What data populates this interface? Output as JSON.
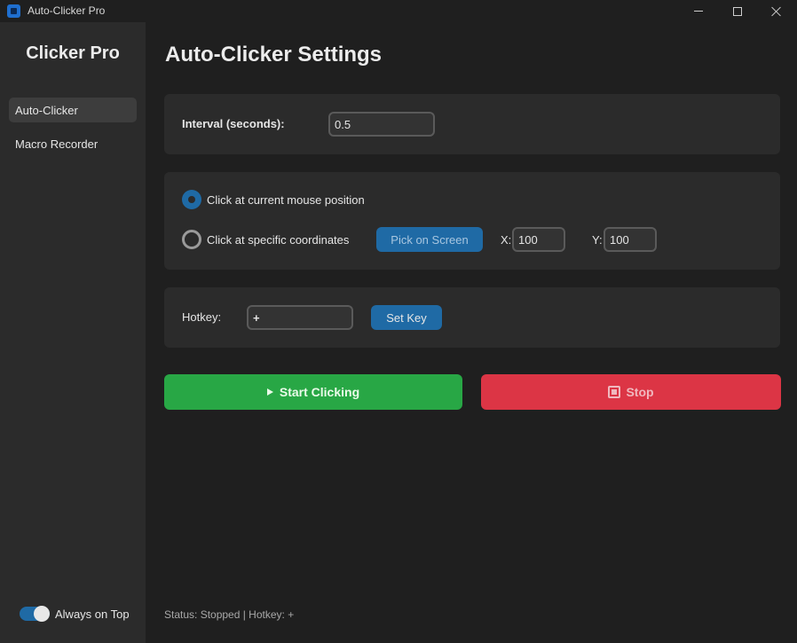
{
  "window": {
    "title": "Auto-Clicker Pro",
    "controls": [
      "minimize",
      "maximize",
      "close"
    ]
  },
  "sidebar": {
    "brand": "Clicker Pro",
    "items": [
      {
        "label": "Auto-Clicker",
        "active": true
      },
      {
        "label": "Macro Recorder",
        "active": false
      }
    ],
    "always_on_top": {
      "label": "Always on Top",
      "enabled": true
    }
  },
  "main": {
    "title": "Auto-Clicker Settings",
    "interval": {
      "label": "Interval (seconds):",
      "value": "0.5"
    },
    "click_position": {
      "options": [
        {
          "label": "Click at current mouse position",
          "selected": true
        },
        {
          "label": "Click at specific coordinates",
          "selected": false
        }
      ],
      "pick_button": "Pick on Screen",
      "x_label": "X:",
      "x_value": "100",
      "y_label": "Y:",
      "y_value": "100"
    },
    "hotkey": {
      "label": "Hotkey:",
      "value": "+",
      "set_button": "Set Key"
    },
    "start_button": "Start Clicking",
    "stop_button": "Stop",
    "status": "Status: Stopped | Hotkey: +"
  },
  "colors": {
    "accent": "#1f6aa5",
    "start": "#28a745",
    "stop": "#dc3545",
    "panel": "#2b2b2b",
    "background": "#1f1f1f"
  }
}
